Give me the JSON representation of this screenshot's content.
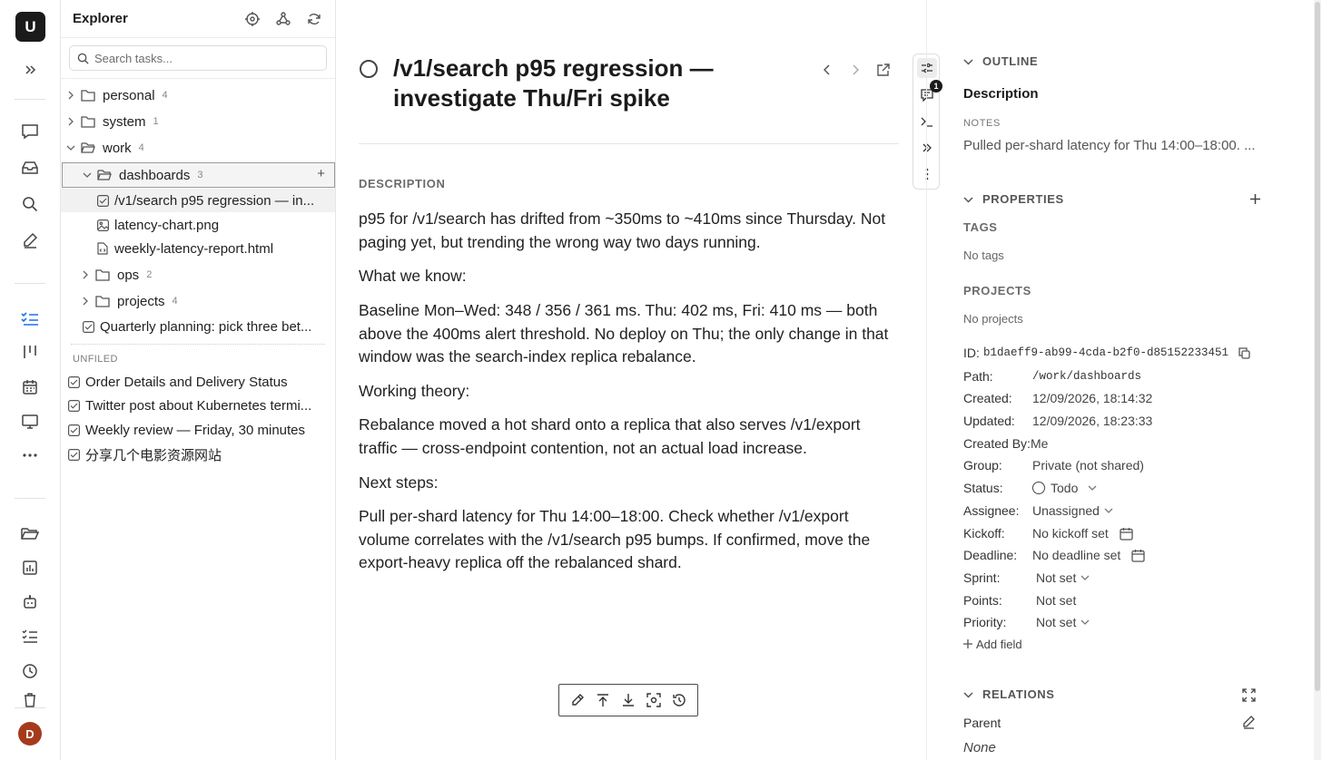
{
  "rail": {
    "logo_letter": "U",
    "avatar_letter": "D"
  },
  "explorer": {
    "title": "Explorer",
    "search_placeholder": "Search tasks...",
    "tree": [
      {
        "label": "personal",
        "count": "4"
      },
      {
        "label": "system",
        "count": "1"
      },
      {
        "label": "work",
        "count": "4"
      },
      {
        "label": "dashboards",
        "count": "3"
      },
      {
        "label": "/v1/search p95 regression — in..."
      },
      {
        "label": "latency-chart.png"
      },
      {
        "label": "weekly-latency-report.html"
      },
      {
        "label": "ops",
        "count": "2"
      },
      {
        "label": "projects",
        "count": "4"
      },
      {
        "label": "Quarterly planning: pick three bet..."
      }
    ],
    "unfiled_label": "UNFILED",
    "unfiled": [
      {
        "label": "Order Details and Delivery Status"
      },
      {
        "label": "Twitter post about Kubernetes termi..."
      },
      {
        "label": "Weekly review — Friday, 30 minutes"
      },
      {
        "label": "分享几个电影资源网站"
      }
    ]
  },
  "task": {
    "title": "/v1/search p95 regression — investigate Thu/Fri spike",
    "description_heading": "DESCRIPTION",
    "paragraphs": [
      "p95 for /v1/search has drifted from ~350ms to ~410ms since Thursday. Not paging yet, but trending the wrong way two days running.",
      "What we know:",
      "Baseline Mon–Wed: 348 / 356 / 361 ms. Thu: 402 ms, Fri: 410 ms — both above the 400ms alert threshold. No deploy on Thu; the only change in that window was the search-index replica rebalance.",
      "Working theory:",
      "Rebalance moved a hot shard onto a replica that also serves /v1/export traffic — cross-endpoint contention, not an actual load increase.",
      "Next steps:",
      "Pull per-shard latency for Thu 14:00–18:00. Check whether /v1/export volume correlates with the /v1/search p95 bumps. If confirmed, move the export-heavy replica off the rebalanced shard."
    ]
  },
  "toolstrip": {
    "comment_badge": "1"
  },
  "panel": {
    "outline": {
      "heading": "OUTLINE",
      "item": "Description",
      "notes_label": "NOTES",
      "notes_text": "Pulled per-shard latency for Thu 14:00–18:00. ..."
    },
    "properties": {
      "heading": "PROPERTIES",
      "tags_label": "TAGS",
      "tags_value": "No tags",
      "projects_label": "PROJECTS",
      "projects_value": "No projects",
      "id_label": "ID:",
      "id_value": "b1daeff9-ab99-4cda-b2f0-d85152233451",
      "rows": [
        {
          "key": "Path:",
          "value": "/work/dashboards"
        },
        {
          "key": "Created:",
          "value": "12/09/2026, 18:14:32"
        },
        {
          "key": "Updated:",
          "value": "12/09/2026, 18:23:33"
        },
        {
          "key": "Created By:",
          "value": "Me"
        },
        {
          "key": "Group:",
          "value": "Private (not shared)"
        },
        {
          "key": "Status:",
          "value": "Todo"
        },
        {
          "key": "Assignee:",
          "value": "Unassigned"
        },
        {
          "key": "Kickoff:",
          "value": "No kickoff set"
        },
        {
          "key": "Deadline:",
          "value": "No deadline set"
        },
        {
          "key": "Sprint:",
          "value": "Not set"
        },
        {
          "key": "Points:",
          "value": "Not set"
        },
        {
          "key": "Priority:",
          "value": "Not set"
        }
      ],
      "add_field": "Add field"
    },
    "relations": {
      "heading": "RELATIONS",
      "parent_label": "Parent",
      "parent_value": "None"
    }
  }
}
